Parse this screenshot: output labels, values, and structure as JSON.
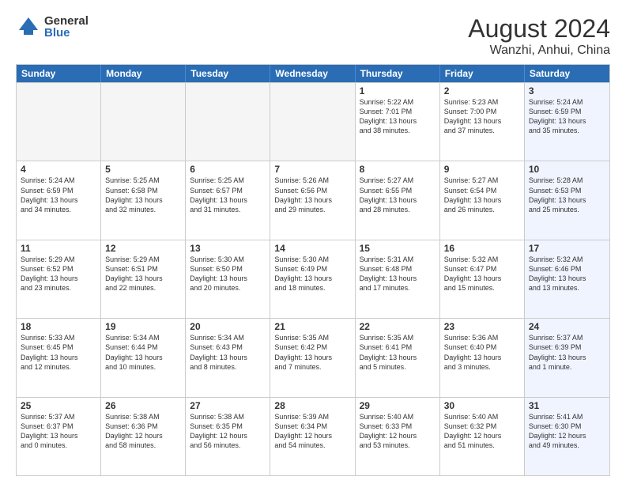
{
  "logo": {
    "general": "General",
    "blue": "Blue"
  },
  "title": "August 2024",
  "location": "Wanzhi, Anhui, China",
  "days_of_week": [
    "Sunday",
    "Monday",
    "Tuesday",
    "Wednesday",
    "Thursday",
    "Friday",
    "Saturday"
  ],
  "weeks": [
    [
      {
        "day": "",
        "info": "",
        "empty": true
      },
      {
        "day": "",
        "info": "",
        "empty": true
      },
      {
        "day": "",
        "info": "",
        "empty": true
      },
      {
        "day": "",
        "info": "",
        "empty": true
      },
      {
        "day": "1",
        "info": "Sunrise: 5:22 AM\nSunset: 7:01 PM\nDaylight: 13 hours\nand 38 minutes."
      },
      {
        "day": "2",
        "info": "Sunrise: 5:23 AM\nSunset: 7:00 PM\nDaylight: 13 hours\nand 37 minutes."
      },
      {
        "day": "3",
        "info": "Sunrise: 5:24 AM\nSunset: 6:59 PM\nDaylight: 13 hours\nand 35 minutes.",
        "saturday": true
      }
    ],
    [
      {
        "day": "4",
        "info": "Sunrise: 5:24 AM\nSunset: 6:59 PM\nDaylight: 13 hours\nand 34 minutes."
      },
      {
        "day": "5",
        "info": "Sunrise: 5:25 AM\nSunset: 6:58 PM\nDaylight: 13 hours\nand 32 minutes."
      },
      {
        "day": "6",
        "info": "Sunrise: 5:25 AM\nSunset: 6:57 PM\nDaylight: 13 hours\nand 31 minutes."
      },
      {
        "day": "7",
        "info": "Sunrise: 5:26 AM\nSunset: 6:56 PM\nDaylight: 13 hours\nand 29 minutes."
      },
      {
        "day": "8",
        "info": "Sunrise: 5:27 AM\nSunset: 6:55 PM\nDaylight: 13 hours\nand 28 minutes."
      },
      {
        "day": "9",
        "info": "Sunrise: 5:27 AM\nSunset: 6:54 PM\nDaylight: 13 hours\nand 26 minutes."
      },
      {
        "day": "10",
        "info": "Sunrise: 5:28 AM\nSunset: 6:53 PM\nDaylight: 13 hours\nand 25 minutes.",
        "saturday": true
      }
    ],
    [
      {
        "day": "11",
        "info": "Sunrise: 5:29 AM\nSunset: 6:52 PM\nDaylight: 13 hours\nand 23 minutes."
      },
      {
        "day": "12",
        "info": "Sunrise: 5:29 AM\nSunset: 6:51 PM\nDaylight: 13 hours\nand 22 minutes."
      },
      {
        "day": "13",
        "info": "Sunrise: 5:30 AM\nSunset: 6:50 PM\nDaylight: 13 hours\nand 20 minutes."
      },
      {
        "day": "14",
        "info": "Sunrise: 5:30 AM\nSunset: 6:49 PM\nDaylight: 13 hours\nand 18 minutes."
      },
      {
        "day": "15",
        "info": "Sunrise: 5:31 AM\nSunset: 6:48 PM\nDaylight: 13 hours\nand 17 minutes."
      },
      {
        "day": "16",
        "info": "Sunrise: 5:32 AM\nSunset: 6:47 PM\nDaylight: 13 hours\nand 15 minutes."
      },
      {
        "day": "17",
        "info": "Sunrise: 5:32 AM\nSunset: 6:46 PM\nDaylight: 13 hours\nand 13 minutes.",
        "saturday": true
      }
    ],
    [
      {
        "day": "18",
        "info": "Sunrise: 5:33 AM\nSunset: 6:45 PM\nDaylight: 13 hours\nand 12 minutes."
      },
      {
        "day": "19",
        "info": "Sunrise: 5:34 AM\nSunset: 6:44 PM\nDaylight: 13 hours\nand 10 minutes."
      },
      {
        "day": "20",
        "info": "Sunrise: 5:34 AM\nSunset: 6:43 PM\nDaylight: 13 hours\nand 8 minutes."
      },
      {
        "day": "21",
        "info": "Sunrise: 5:35 AM\nSunset: 6:42 PM\nDaylight: 13 hours\nand 7 minutes."
      },
      {
        "day": "22",
        "info": "Sunrise: 5:35 AM\nSunset: 6:41 PM\nDaylight: 13 hours\nand 5 minutes."
      },
      {
        "day": "23",
        "info": "Sunrise: 5:36 AM\nSunset: 6:40 PM\nDaylight: 13 hours\nand 3 minutes."
      },
      {
        "day": "24",
        "info": "Sunrise: 5:37 AM\nSunset: 6:39 PM\nDaylight: 13 hours\nand 1 minute.",
        "saturday": true
      }
    ],
    [
      {
        "day": "25",
        "info": "Sunrise: 5:37 AM\nSunset: 6:37 PM\nDaylight: 13 hours\nand 0 minutes."
      },
      {
        "day": "26",
        "info": "Sunrise: 5:38 AM\nSunset: 6:36 PM\nDaylight: 12 hours\nand 58 minutes."
      },
      {
        "day": "27",
        "info": "Sunrise: 5:38 AM\nSunset: 6:35 PM\nDaylight: 12 hours\nand 56 minutes."
      },
      {
        "day": "28",
        "info": "Sunrise: 5:39 AM\nSunset: 6:34 PM\nDaylight: 12 hours\nand 54 minutes."
      },
      {
        "day": "29",
        "info": "Sunrise: 5:40 AM\nSunset: 6:33 PM\nDaylight: 12 hours\nand 53 minutes."
      },
      {
        "day": "30",
        "info": "Sunrise: 5:40 AM\nSunset: 6:32 PM\nDaylight: 12 hours\nand 51 minutes."
      },
      {
        "day": "31",
        "info": "Sunrise: 5:41 AM\nSunset: 6:30 PM\nDaylight: 12 hours\nand 49 minutes.",
        "saturday": true
      }
    ]
  ]
}
